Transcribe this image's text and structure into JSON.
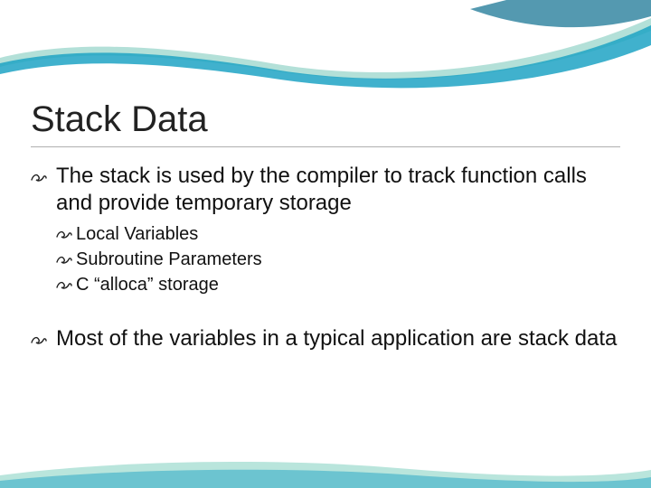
{
  "title": "Stack Data",
  "bullets": {
    "b1": "The stack is used by the compiler to track function calls and provide temporary storage",
    "sub1": "Local Variables",
    "sub2": "Subroutine Parameters",
    "sub3": "C “alloca” storage",
    "b2": "Most of the variables in a typical application are stack data"
  },
  "marker": "་"
}
